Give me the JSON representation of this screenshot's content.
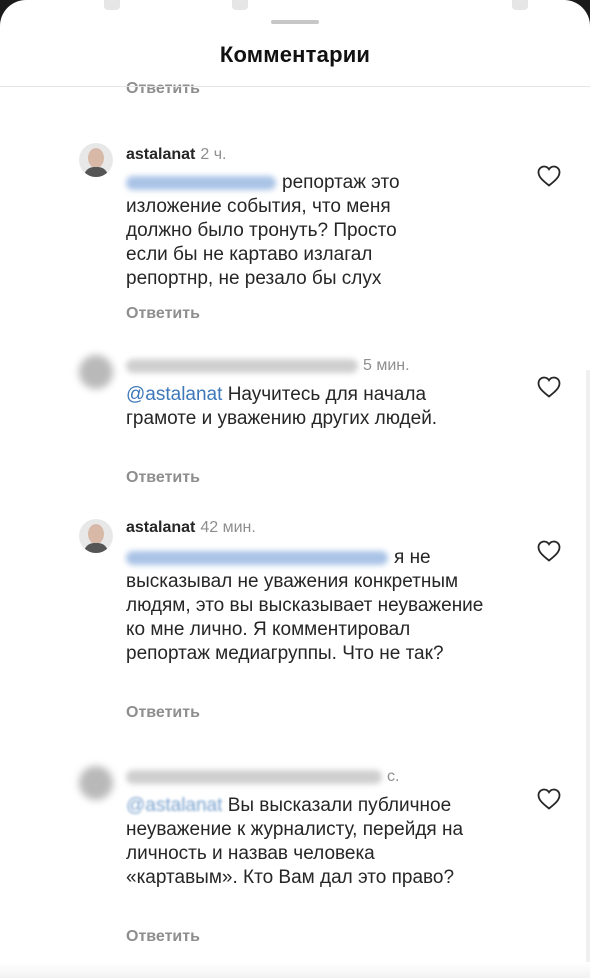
{
  "sheet": {
    "title": "Комментарии"
  },
  "top_reply_label": "Ответить",
  "comments": [
    {
      "username": "astalanat",
      "time": "2 ч.",
      "text": "репортаж это изложение события, что меня должно было тронуть? Просто если бы не картаво излагал репортнр, не резало бы слух",
      "reply_label": "Ответить"
    },
    {
      "time": "5 мин.",
      "mention": "@astalanat",
      "text": "Научитесь для начала грамоте и уважению других людей.",
      "reply_label": "Ответить"
    },
    {
      "username": "astalanat",
      "time": "42 мин.",
      "text": "я не высказывал не уважения конкретным людям, это вы высказывает неуважение ко мне лично. Я комментировал репортаж медиагруппы. Что не так?",
      "reply_label": "Ответить"
    },
    {
      "time": "с.",
      "mention": "@astalanat",
      "text": "Вы высказали публичное неуважение к журналисту, перейдя на личность и назвав человека «картавым». Кто Вам дал это право?",
      "reply_label": "Ответить"
    }
  ],
  "icons": {
    "like": "heart-outline-icon"
  },
  "colors": {
    "mention": "#3d78b8",
    "secondary_text": "#8e8e8e",
    "primary_text": "#262626"
  }
}
